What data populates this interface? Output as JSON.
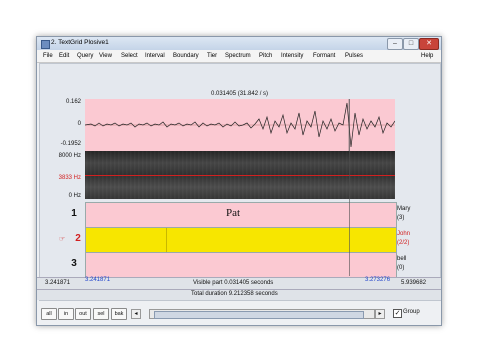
{
  "window": {
    "title": "2. TextGrid Plosive1"
  },
  "menu": [
    "File",
    "Edit",
    "Query",
    "View",
    "Select",
    "Interval",
    "Boundary",
    "Tier",
    "Spectrum",
    "Pitch",
    "Intensity",
    "Formant",
    "Pulses",
    "Help"
  ],
  "selection_label": "0.031405 (31.842 / s)",
  "waveform": {
    "ymax": "0.162",
    "yzero": "0",
    "ymin": "-0.1952"
  },
  "spectrogram": {
    "ymax": "8000 Hz",
    "cursor": "3833 Hz",
    "ymin": "0 Hz"
  },
  "tiers": [
    {
      "num": "1",
      "text": "Pat",
      "name": "Mary",
      "count": "(3)"
    },
    {
      "num": "2",
      "text": "",
      "name": "John",
      "count": "(2/2)",
      "marker": "☞"
    },
    {
      "num": "3",
      "text": "",
      "name": "bell",
      "count": "(0)"
    }
  ],
  "bottom": {
    "left_time": "3.241871",
    "left_time_blue": "3.241871",
    "visible": "Visible part 0.031405 seconds",
    "right_time_blue": "3.273276",
    "right_time": "5.939682",
    "total": "Total duration 9.212358 seconds"
  },
  "toolbar": {
    "all": "all",
    "in": "in",
    "out": "out",
    "sel": "sel",
    "bak": "bak",
    "group": "Group"
  },
  "colors": {
    "pink": "#fbc9d2",
    "yellow": "#f7e600",
    "accent_red": "#d22020",
    "accent_blue": "#2244cc"
  }
}
